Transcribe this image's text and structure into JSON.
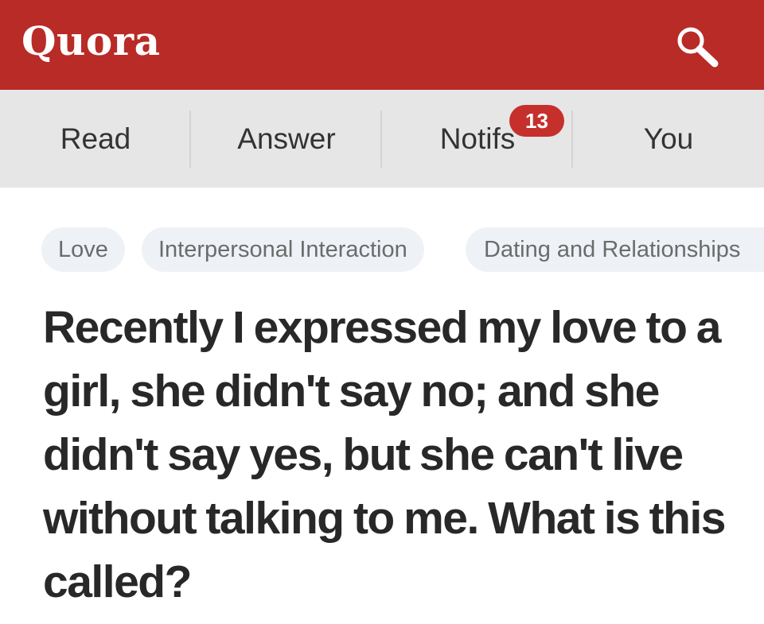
{
  "header": {
    "logo": "Quora",
    "search_icon": "search-icon",
    "brand_color": "#b92b27"
  },
  "tabs": [
    {
      "label": "Read"
    },
    {
      "label": "Answer"
    },
    {
      "label": "Notifs",
      "badge": "13"
    },
    {
      "label": "You"
    }
  ],
  "topics": [
    "Love",
    "Interpersonal Interaction",
    "Dating and Relationships"
  ],
  "question": {
    "title": "Recently I expressed my love to a girl, she didn't say no; and she didn't say yes, but she can't live without talking to me. What is this called?"
  }
}
